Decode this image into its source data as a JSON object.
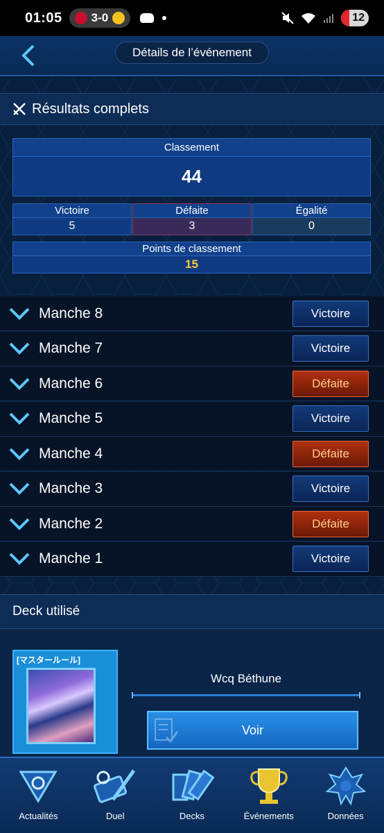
{
  "status_bar": {
    "time": "01:05",
    "score": "3-0",
    "battery": "12",
    "team1_color": "#c8102e",
    "team2_color": "#f2c21b"
  },
  "header": {
    "title": "Détails de l’événement"
  },
  "results": {
    "section_title": "Résultats complets",
    "ranking_label": "Classement",
    "ranking_value": "44",
    "wins_label": "Victoire",
    "wins_value": "5",
    "losses_label": "Défaite",
    "losses_value": "3",
    "draws_label": "Égalité",
    "draws_value": "0",
    "points_label": "Points de classement",
    "points_value": "15"
  },
  "rounds": [
    {
      "label": "Manche 8",
      "result": "Victoire",
      "type": "win"
    },
    {
      "label": "Manche 7",
      "result": "Victoire",
      "type": "win"
    },
    {
      "label": "Manche 6",
      "result": "Défaite",
      "type": "loss"
    },
    {
      "label": "Manche 5",
      "result": "Victoire",
      "type": "win"
    },
    {
      "label": "Manche 4",
      "result": "Défaite",
      "type": "loss"
    },
    {
      "label": "Manche 3",
      "result": "Victoire",
      "type": "win"
    },
    {
      "label": "Manche 2",
      "result": "Défaite",
      "type": "loss"
    },
    {
      "label": "Manche 1",
      "result": "Victoire",
      "type": "win"
    }
  ],
  "deck": {
    "section_title": "Deck utilisé",
    "tag": "[マスタールール]",
    "name": "Wcq Béthune",
    "view_button": "Voir"
  },
  "nav": [
    {
      "label": "Actualités",
      "icon": "news-icon"
    },
    {
      "label": "Duel",
      "icon": "duel-icon"
    },
    {
      "label": "Decks",
      "icon": "decks-icon"
    },
    {
      "label": "Événements",
      "icon": "trophy-icon"
    },
    {
      "label": "Données",
      "icon": "data-icon"
    }
  ],
  "colors": {
    "accent": "#2b66b8",
    "win_badge": "#0b2557",
    "loss_badge": "#b0300f",
    "points_color": "#ffc93a"
  }
}
